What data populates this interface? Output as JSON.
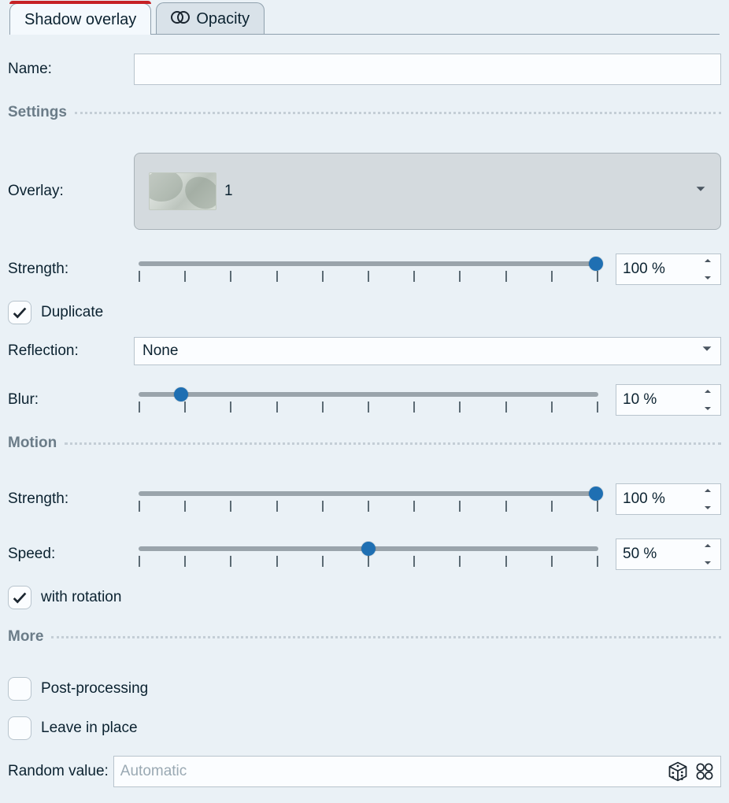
{
  "tabs": {
    "shadow_overlay": "Shadow overlay",
    "opacity": "Opacity"
  },
  "labels": {
    "name": "Name:",
    "overlay": "Overlay:",
    "strength": "Strength:",
    "reflection": "Reflection:",
    "blur": "Blur:",
    "speed": "Speed:",
    "random_value": "Random value:"
  },
  "sections": {
    "settings": "Settings",
    "motion": "Motion",
    "more": "More"
  },
  "overlay": {
    "selected_label": "1"
  },
  "settings": {
    "strength": {
      "value": 100,
      "display": "100 %"
    },
    "duplicate": {
      "label": "Duplicate",
      "checked": true
    },
    "reflection": {
      "value": "None"
    },
    "blur": {
      "value": 10,
      "display": "10 %"
    }
  },
  "motion": {
    "strength": {
      "value": 100,
      "display": "100 %"
    },
    "speed": {
      "value": 50,
      "display": "50 %"
    },
    "with_rotation": {
      "label": "with rotation",
      "checked": true
    }
  },
  "more": {
    "post_processing": {
      "label": "Post-processing",
      "checked": false
    },
    "leave_in_place": {
      "label": "Leave in place",
      "checked": false
    },
    "random_value": {
      "placeholder": "Automatic"
    }
  },
  "name_value": ""
}
